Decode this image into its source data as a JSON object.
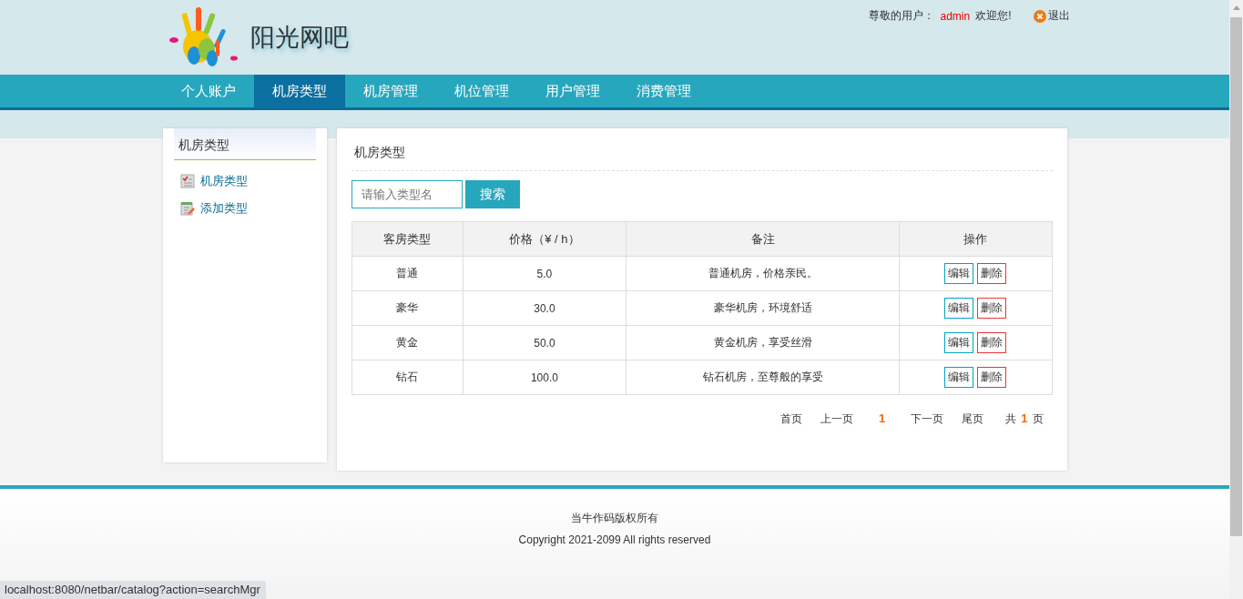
{
  "header": {
    "site_name": "阳光网吧",
    "greeting": "尊敬的用户：",
    "username": "admin",
    "welcome": "欢迎您!",
    "logout": "退出"
  },
  "nav": [
    {
      "label": "个人账户",
      "selected": false
    },
    {
      "label": "机房类型",
      "selected": true
    },
    {
      "label": "机房管理",
      "selected": false
    },
    {
      "label": "机位管理",
      "selected": false
    },
    {
      "label": "用户管理",
      "selected": false
    },
    {
      "label": "消费管理",
      "selected": false
    }
  ],
  "sidebar": {
    "title": "机房类型",
    "items": [
      {
        "label": "机房类型",
        "kind": "list"
      },
      {
        "label": "添加类型",
        "kind": "add"
      }
    ]
  },
  "main": {
    "title": "机房类型",
    "search": {
      "placeholder": "请输入类型名",
      "button": "搜索"
    },
    "table": {
      "columns": [
        "客房类型",
        "价格（¥ / h）",
        "备注",
        "操作"
      ],
      "rows": [
        {
          "cells": [
            "普通",
            "5.0",
            "普通机房，价格亲民。"
          ],
          "actions": [
            "编辑",
            "删除"
          ]
        },
        {
          "cells": [
            "豪华",
            "30.0",
            "豪华机房，环境舒适"
          ],
          "actions": [
            "编辑",
            "删除"
          ]
        },
        {
          "cells": [
            "黄金",
            "50.0",
            "黄金机房，享受丝滑"
          ],
          "actions": [
            "编辑",
            "删除"
          ]
        },
        {
          "cells": [
            "钻石",
            "100.0",
            "钻石机房，至尊般的享受"
          ],
          "actions": [
            "编辑",
            "删除"
          ]
        }
      ]
    },
    "pager": {
      "items": [
        {
          "label": "首页",
          "selected": false
        },
        {
          "label": "上一页",
          "selected": false
        },
        {
          "label": "1",
          "selected": true
        },
        {
          "label": "下一页",
          "selected": false
        },
        {
          "label": "尾页",
          "selected": false
        }
      ],
      "total_prefix": "共",
      "total": "1",
      "total_suffix": "页"
    }
  },
  "footer": {
    "lines": [
      "当牛作码版权所有",
      "Copyright 2021-2099 All rights reserved"
    ]
  },
  "status_bar": "localhost:8080/netbar/catalog?action=searchMgr"
}
